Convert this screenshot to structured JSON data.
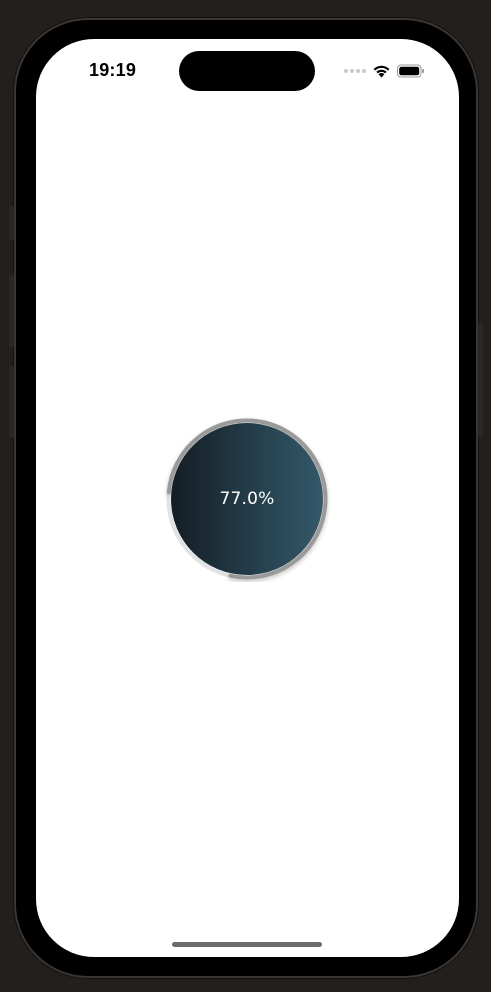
{
  "status_bar": {
    "time": "19:19",
    "icons": [
      "cellular-dots-icon",
      "wifi-icon",
      "battery-icon"
    ]
  },
  "progress": {
    "label": "77.0%",
    "value": 0.77
  },
  "colors": {
    "gradient_start": "#141d24",
    "gradient_end": "#33596b",
    "ring_track": "#e2e2e2",
    "ring_progress": "#9a9a9a"
  }
}
